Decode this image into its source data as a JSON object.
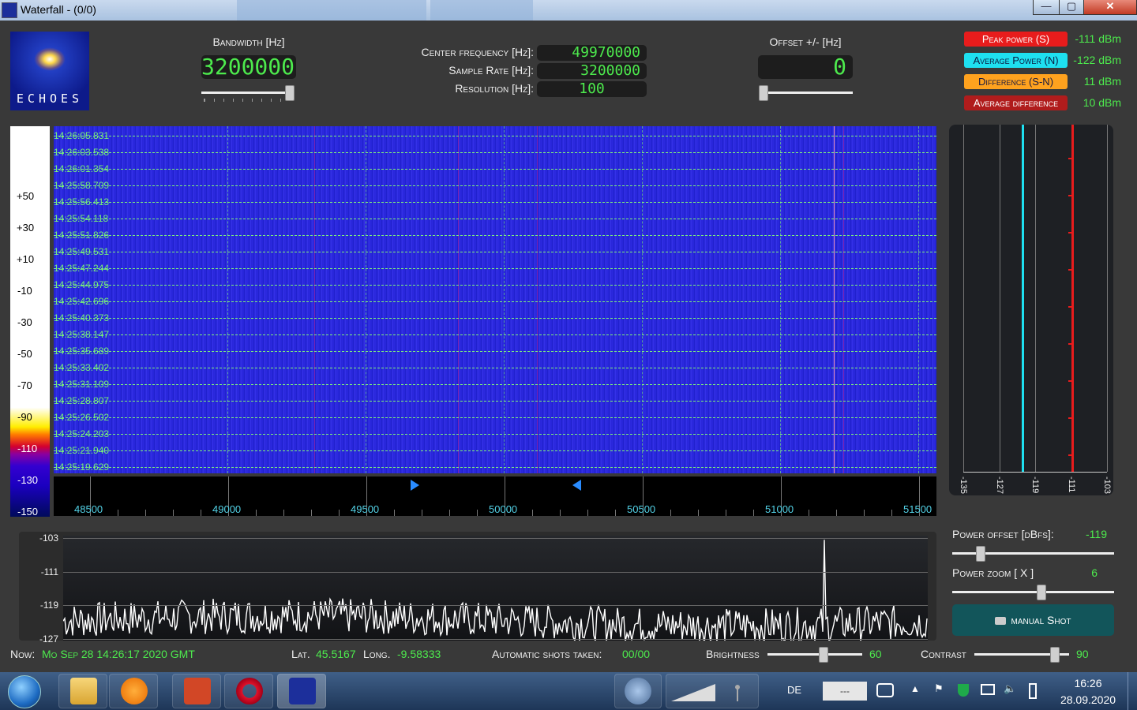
{
  "window": {
    "title": "Waterfall - (0/0)",
    "minimize": "—",
    "maximize": "▢",
    "close": "✕"
  },
  "logo": {
    "text": "ECHOES"
  },
  "controls": {
    "bandwidth_label": "Bandwidth [Hz]",
    "bandwidth_value": "3200000",
    "center_freq_label": "Center frequency [Hz]:",
    "center_freq_value": "49970000",
    "sample_rate_label": "Sample Rate [Hz]:",
    "sample_rate_value": "3200000",
    "resolution_label": "Resolution [Hz]:",
    "resolution_value": "100",
    "offset_label": "Offset +/- [Hz]",
    "offset_value": "0"
  },
  "indicators": [
    {
      "label": "Peak power (S)",
      "value": "-111 dBm",
      "bg": "#e81c1c",
      "fg": "#ffffff"
    },
    {
      "label": "Average Power (N)",
      "value": "-122 dBm",
      "bg": "#1ee0f0",
      "fg": "#0b1a40"
    },
    {
      "label": "Difference (S-N)",
      "value": "11 dBm",
      "bg": "#ffa21e",
      "fg": "#1a1a40"
    },
    {
      "label": "Average difference",
      "value": "10 dBm",
      "bg": "#b01c1c",
      "fg": "#ffffff"
    }
  ],
  "color_scale": [
    "+50",
    "+30",
    "+10",
    "-10",
    "-30",
    "-50",
    "-70",
    "-90",
    "-110",
    "-130",
    "-150"
  ],
  "timestamps": [
    "14:26:05.831",
    "14:26:03.538",
    "14:26:01.354",
    "14:25:58.709",
    "14:25:56.413",
    "14:25:54.118",
    "14:25:51.826",
    "14:25:49.531",
    "14:25:47.244",
    "14:25:44.975",
    "14:25:42.696",
    "14:25:40.373",
    "14:25:38.147",
    "14:25:35.689",
    "14:25:33.402",
    "14:25:31.109",
    "14:25:28.807",
    "14:25:26.502",
    "14:25:24.203",
    "14:25:21.940",
    "14:25:19.629"
  ],
  "freq_axis": [
    "48500",
    "49000",
    "49500",
    "50000",
    "50500",
    "51000",
    "51500"
  ],
  "power_meter": {
    "labels": [
      "-135",
      "-127",
      "-119",
      "-111",
      "-103"
    ],
    "average_dbm": -122,
    "peak_dbm": -111
  },
  "spectrum": {
    "y_labels": [
      "-103",
      "-111",
      "-119",
      "-127"
    ],
    "ylim": [
      -128,
      -103
    ],
    "peak_fraction": 0.88
  },
  "right_panel": {
    "power_offset_label": "Power offset [dBfs]:",
    "power_offset_value": "-119",
    "power_zoom_label": "Power zoom  [ X ]",
    "power_zoom_value": "6",
    "manual_shot_label": "manual Shot"
  },
  "status": {
    "now_label": "Now:",
    "now_value": "Mo Sep 28 14:26:17 2020 GMT",
    "lat_label": "Lat.",
    "lat_value": "45.5167",
    "long_label": "Long.",
    "long_value": "-9.58333",
    "shots_label": "Automatic shots taken:",
    "shots_value": "00/00",
    "brightness_label": "Brightness",
    "brightness_value": "60",
    "contrast_label": "Contrast",
    "contrast_value": "90"
  },
  "taskbar": {
    "language": "DE",
    "search_placeholder": "---",
    "time": "16:26",
    "date": "28.09.2020"
  }
}
